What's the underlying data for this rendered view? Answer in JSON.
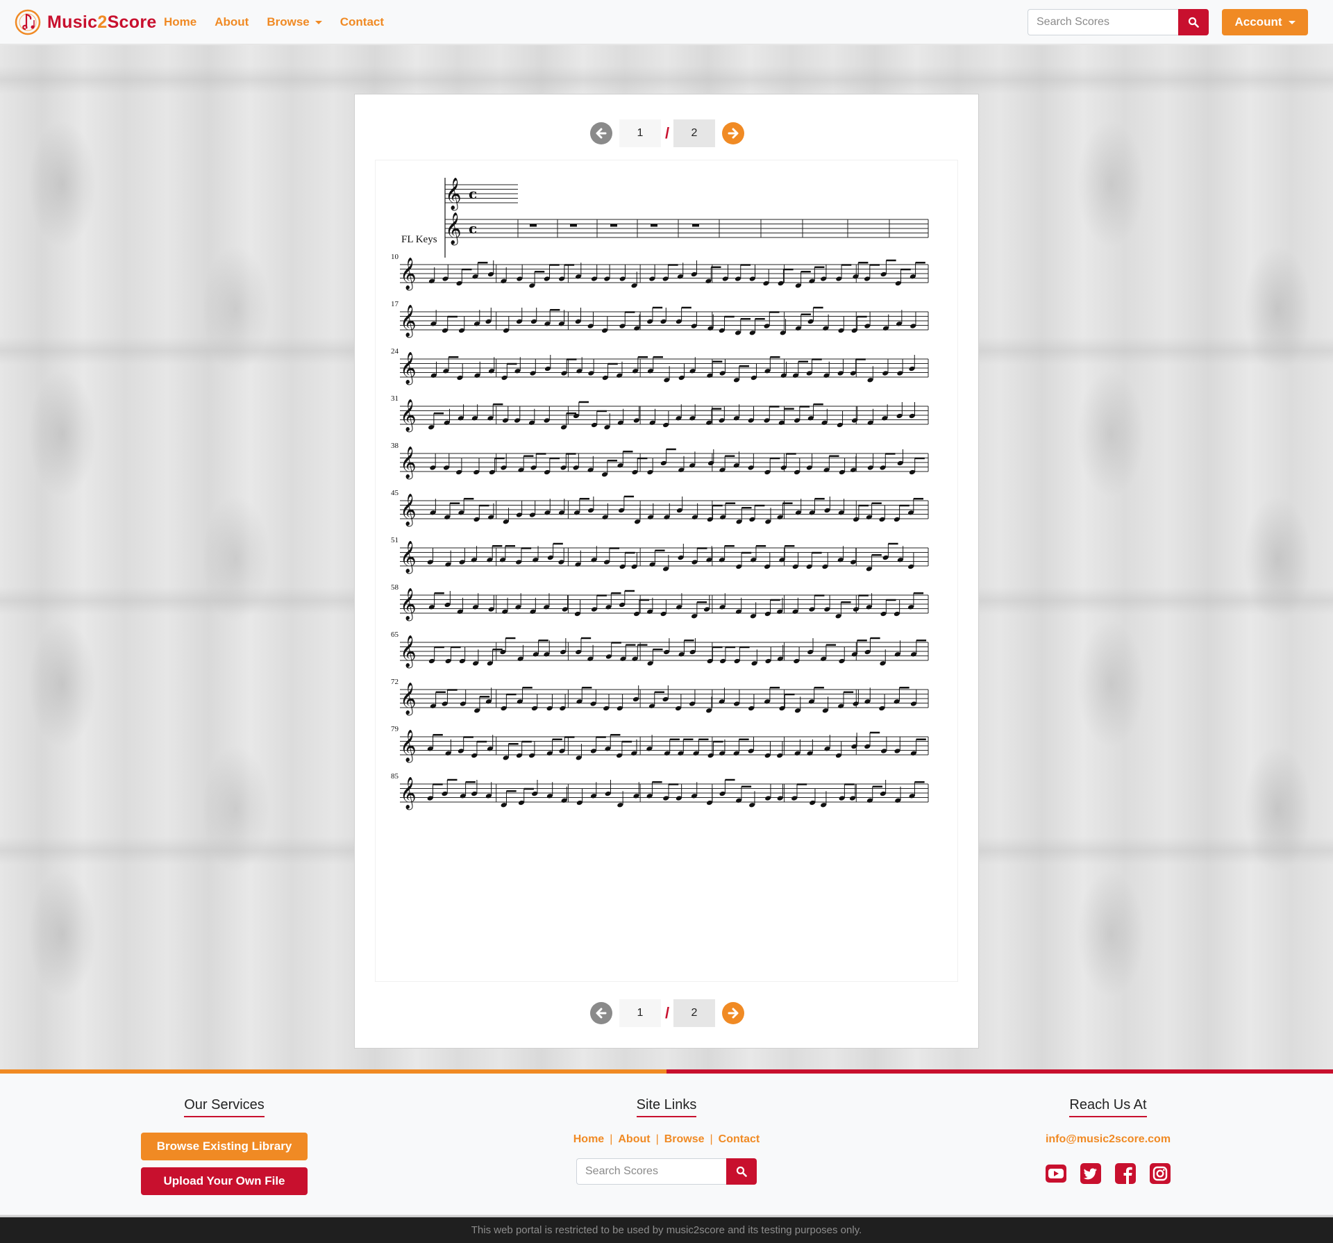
{
  "brand": {
    "name_part1": "Music",
    "name_part2": "2",
    "name_part3": "Score"
  },
  "nav": {
    "links": [
      "Home",
      "About",
      "Browse",
      "Contact"
    ],
    "search_placeholder": "Search Scores",
    "account_label": "Account"
  },
  "pager": {
    "current_page": "1",
    "separator": "/",
    "total_pages": "2"
  },
  "score": {
    "instrument": "FL Keys",
    "measure_numbers": [
      "10",
      "17",
      "24",
      "31",
      "38",
      "45",
      "51",
      "58",
      "65",
      "72",
      "79",
      "85"
    ]
  },
  "footer": {
    "services_title": "Our Services",
    "browse_button": "Browse Existing Library",
    "upload_button": "Upload Your Own File",
    "links_title": "Site Links",
    "links": [
      "Home",
      "About",
      "Browse",
      "Contact"
    ],
    "link_separator": "|",
    "search_placeholder": "Search Scores",
    "contact_title": "Reach Us At",
    "email": "info@music2score.com",
    "social": [
      "youtube-icon",
      "twitter-icon",
      "facebook-icon",
      "instagram-icon"
    ],
    "disclaimer": "This web portal is restricted to be used by music2score and its testing purposes only."
  },
  "colors": {
    "brand_orange": "#f08a24",
    "brand_red": "#c8102e"
  }
}
